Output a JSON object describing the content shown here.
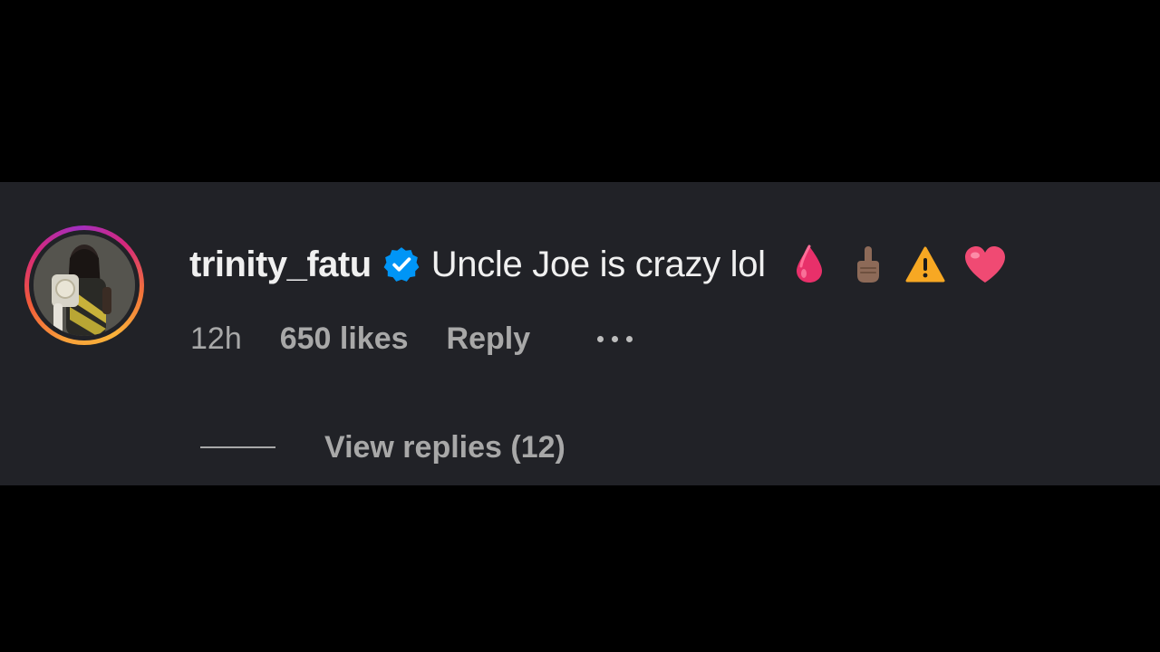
{
  "comment": {
    "username": "trinity_fatu",
    "text": "Uncle Joe is crazy lol",
    "emojis": [
      "drop-of-blood-icon",
      "index-pointing-up-icon",
      "warning-icon",
      "heart-icon"
    ],
    "verified_icon": "verified-badge-icon",
    "avatar_icon": "profile-photo"
  },
  "meta": {
    "time": "12h",
    "likes": "650 likes",
    "reply_label": "Reply",
    "more_icon": "more-options-icon"
  },
  "replies": {
    "label": "View replies (12)"
  },
  "colors": {
    "background": "#000000",
    "card": "#212227",
    "text_primary": "#f0f0f0",
    "text_secondary": "#a8a8a8",
    "verified": "#0095f6",
    "ring_start": "#f9a03a",
    "ring_mid": "#d6287a",
    "ring_end": "#a22fc1"
  }
}
